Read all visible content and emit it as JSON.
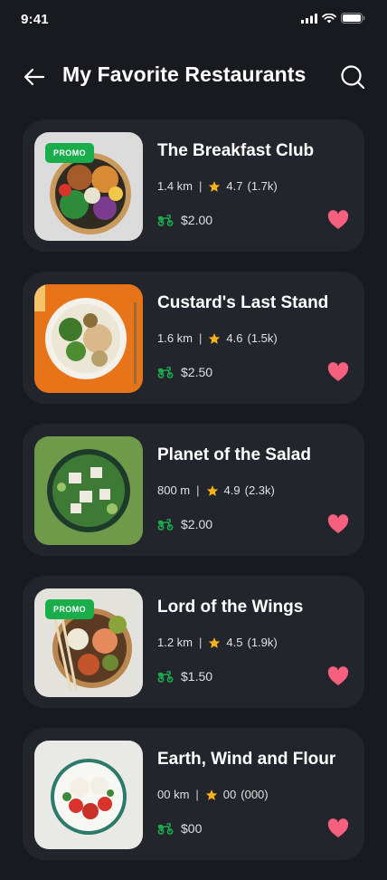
{
  "status": {
    "time": "9:41"
  },
  "header": {
    "title": "My Favorite Restaurants"
  },
  "colors": {
    "background": "#181a20",
    "card": "#23252d",
    "accent_green": "#1bac4b",
    "star": "#f8b318",
    "heart": "#f75f7f"
  },
  "icons": [
    "back-arrow-icon",
    "search-icon",
    "star-icon",
    "delivery-scooter-icon",
    "heart-icon",
    "signal-icon",
    "wifi-icon",
    "battery-icon"
  ],
  "restaurants": [
    {
      "name": "The Breakfast Club",
      "distance": "1.4 km",
      "rating": "4.7",
      "reviews": "(1.7k)",
      "fee": "$2.00",
      "promo": "PROMO"
    },
    {
      "name": "Custard's Last Stand",
      "distance": "1.6 km",
      "rating": "4.6",
      "reviews": "(1.5k)",
      "fee": "$2.50"
    },
    {
      "name": "Planet of the Salad",
      "distance": "800 m",
      "rating": "4.9",
      "reviews": "(2.3k)",
      "fee": "$2.00"
    },
    {
      "name": "Lord of the Wings",
      "distance": "1.2 km",
      "rating": "4.5",
      "reviews": "(1.9k)",
      "fee": "$1.50",
      "promo": "PROMO"
    },
    {
      "name": "Earth, Wind and Flour",
      "distance": "00 km",
      "rating": "00",
      "reviews": "(000)",
      "fee": "$00"
    }
  ]
}
